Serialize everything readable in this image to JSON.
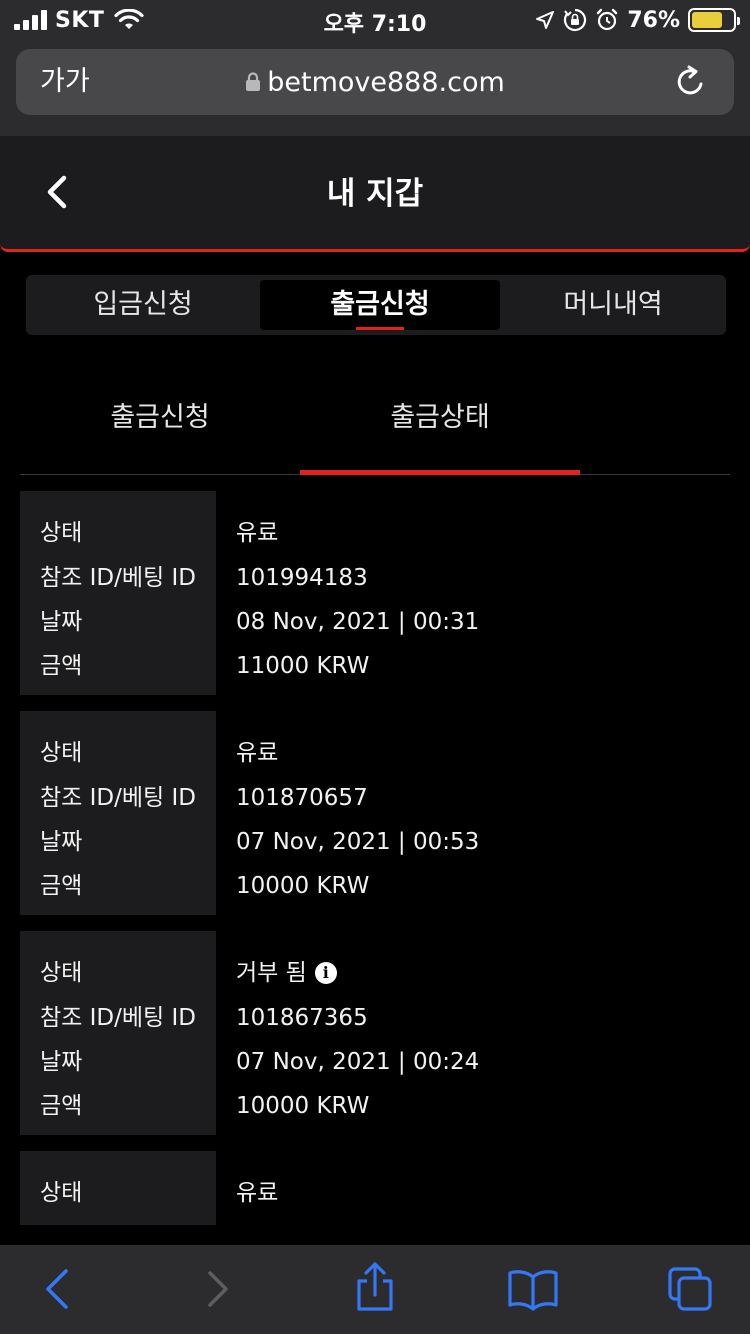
{
  "status_bar": {
    "carrier": "SKT",
    "time": "오후 7:10",
    "battery_percent": "76%",
    "battery_level": 0.76,
    "icons": [
      "signal-icon",
      "wifi-icon",
      "location-icon",
      "orientation-lock-icon",
      "alarm-icon",
      "battery-icon"
    ]
  },
  "browser": {
    "text_size_label": "가가",
    "url": "betmove888.com",
    "icons": [
      "lock-icon",
      "reload-icon"
    ]
  },
  "header": {
    "title": "내 지갑",
    "back_icon": "chevron-left-icon"
  },
  "tabs": [
    {
      "label": "입금신청",
      "active": false
    },
    {
      "label": "출금신청",
      "active": true
    },
    {
      "label": "머니내역",
      "active": false
    }
  ],
  "sub_tabs": [
    {
      "label": "출금신청",
      "active": false
    },
    {
      "label": "출금상태",
      "active": true
    }
  ],
  "field_labels": {
    "status": "상태",
    "ref_id": "참조 ID/베팅 ID",
    "date": "날짜",
    "amount": "금액"
  },
  "records": [
    {
      "status": "유료",
      "ref_id": "101994183",
      "date": "08 Nov, 2021 | 00:31",
      "amount": "11000 KRW",
      "has_info": false
    },
    {
      "status": "유료",
      "ref_id": "101870657",
      "date": "07 Nov, 2021 | 00:53",
      "amount": "10000 KRW",
      "has_info": false
    },
    {
      "status": "거부 됨",
      "ref_id": "101867365",
      "date": "07 Nov, 2021 | 00:24",
      "amount": "10000 KRW",
      "has_info": true
    },
    {
      "status": "유료"
    }
  ],
  "toolbar": {
    "icons": [
      "back-arrow-icon",
      "forward-arrow-icon",
      "share-icon",
      "bookmarks-icon",
      "tabs-icon"
    ]
  },
  "colors": {
    "accent": "#e0241b",
    "ios_blue": "#3478f6",
    "panel": "#1c1c1e",
    "background": "#000000"
  }
}
